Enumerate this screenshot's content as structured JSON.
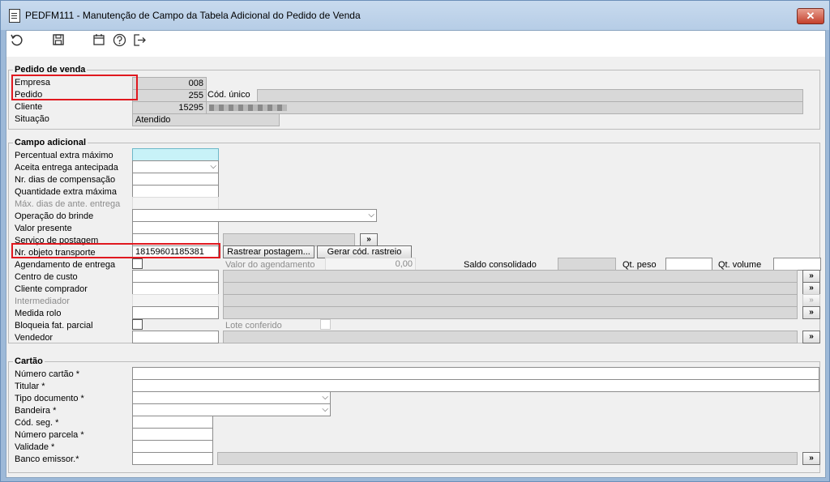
{
  "window": {
    "title": "PEDFM111 - Manutenção de Campo da Tabela Adicional do Pedido de Venda",
    "close_label": "✕"
  },
  "toolbar": {
    "refresh_icon": "refresh-icon",
    "save_icon": "save-icon",
    "calendar_icon": "calendar-icon",
    "help_icon": "help-icon",
    "exit_icon": "exit-icon"
  },
  "pedido": {
    "group_title": "Pedido de venda",
    "empresa_label": "Empresa",
    "empresa_value": "008",
    "pedido_label": "Pedido",
    "pedido_value": "255",
    "cod_unico_label": "Cód. único",
    "cliente_label": "Cliente",
    "cliente_value": "15295",
    "situacao_label": "Situação",
    "situacao_value": "Atendido"
  },
  "campo": {
    "group_title": "Campo adicional",
    "percentual_label": "Percentual extra máximo",
    "aceita_label": "Aceita entrega antecipada",
    "nr_dias_label": "Nr. dias de compensação",
    "quantidade_label": "Quantidade extra máxima",
    "max_dias_label": "Máx. dias de ante. entrega",
    "operacao_label": "Operação do brinde",
    "valor_presente_label": "Valor presente",
    "servico_label": "Serviço de postagem",
    "nr_objeto_label": "Nr. objeto transporte",
    "nr_objeto_value": "18159601185381",
    "rastrear_label": "Rastrear postagem...",
    "gerar_label": "Gerar cód. rastreio",
    "agendamento_label": "Agendamento de entrega",
    "valor_agendamento_label": "Valor do agendamento",
    "valor_agendamento_value": "0,00",
    "saldo_label": "Saldo consolidado",
    "qt_peso_label": "Qt. peso",
    "qt_volume_label": "Qt. volume",
    "centro_label": "Centro de custo",
    "cliente_comprador_label": "Cliente comprador",
    "intermediador_label": "Intermediador",
    "medida_label": "Medida rolo",
    "bloqueia_label": "Bloqueia fat. parcial",
    "lote_label": "Lote conferido",
    "vendedor_label": "Vendedor"
  },
  "cartao": {
    "group_title": "Cartão",
    "numero_label": "Número cartão *",
    "titular_label": "Titular *",
    "tipo_label": "Tipo documento *",
    "bandeira_label": "Bandeira *",
    "cod_seg_label": "Cód. seg. *",
    "parcela_label": "Número parcela *",
    "validade_label": "Validade *",
    "banco_label": "Banco emissor.*"
  },
  "colors": {
    "highlight": "#e0181f",
    "required_field": "#c8f2f8"
  }
}
